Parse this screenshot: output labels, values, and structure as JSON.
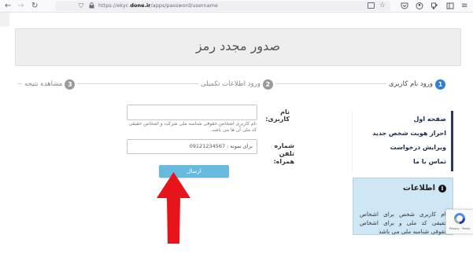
{
  "browser": {
    "url_prefix": "https://ekyc.",
    "url_domain": "done.ir",
    "url_path": "/apps/password/username",
    "back_glyph": "←",
    "forward_glyph": "→",
    "reload_glyph": "↻",
    "star_glyph": "☆"
  },
  "header": {
    "title": "صدور مجدد رمز"
  },
  "steps": [
    {
      "num": "1",
      "label": "ورود نام کاربری"
    },
    {
      "num": "2",
      "label": "ورود اطلاعات تکمیلی"
    },
    {
      "num": "3",
      "label": "مشاهده نتیجه"
    }
  ],
  "menu": [
    {
      "label": "صفحه اول"
    },
    {
      "label": "احراز هویت شخص جدید"
    },
    {
      "label": "ویرایش درخواست"
    },
    {
      "label": "تماس با ما"
    }
  ],
  "info": {
    "title": "اطلاعات",
    "text": "نام کاربری شخص برای اشخاص حقیقی کد ملی و برای اشخاص حقوقی شناسه ملی می باشد"
  },
  "form": {
    "username_label": "نام کاربری:",
    "username_value": "",
    "username_hint": "نام کاربری اشخاص حقوقی شناسه ملی شرکت و اشخاص حقیقی کد ملی آن ها می باشد.",
    "phone_label": "شماره تلفن همراه:",
    "phone_placeholder": "برای نمونه : 09121234567",
    "submit_label": "ارسال"
  },
  "recaptcha": {
    "terms": "Privacy - Terms"
  },
  "colors": {
    "accent": "#2f7fd8",
    "submit": "#67b9dd",
    "arrow": "#e8141c",
    "menu_border": "#2b3a55",
    "info_bg": "#cfe6f5"
  }
}
